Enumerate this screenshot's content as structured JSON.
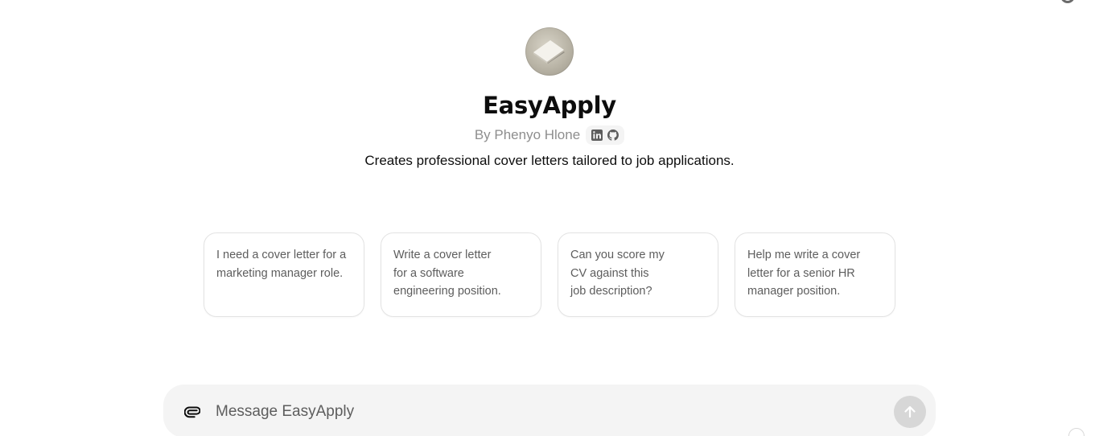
{
  "gpt": {
    "name": "EasyApply",
    "author": "By Phenyo Hlone",
    "description": "Creates professional cover letters tailored to job applications."
  },
  "social": {
    "icons": [
      "linkedin-icon",
      "github-icon"
    ]
  },
  "starters": [
    {
      "label": "I need a cover letter for a\nmarketing manager role."
    },
    {
      "label": "Write a cover letter\nfor a software\nengineering position."
    },
    {
      "label": "Can you score my\nCV against this\njob description?"
    },
    {
      "label": "Help me write a cover\nletter for a senior HR\nmanager position."
    }
  ],
  "composer": {
    "placeholder": "Message EasyApply",
    "value": "",
    "attach_icon": "paperclip-icon",
    "send_icon": "arrow-up-icon"
  },
  "colors": {
    "composer_bg": "#f4f4f4",
    "send_disabled": "#d7d7d7",
    "text_muted": "#8e8e8e"
  }
}
